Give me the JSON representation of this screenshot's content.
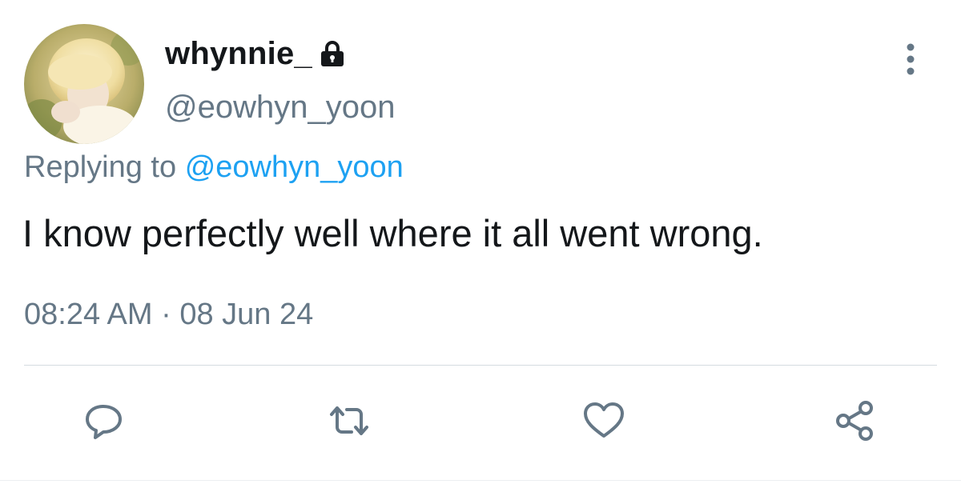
{
  "tweet": {
    "author": {
      "display_name": "whynnie_",
      "handle": "@eowhyn_yoon",
      "protected_icon": "lock-icon",
      "avatar": "profile-photo"
    },
    "reply_to": {
      "prefix": "Replying to",
      "mention": "@eowhyn_yoon"
    },
    "text": "I know perfectly well where it all went wrong.",
    "timestamp": "08:24 AM · 08 Jun 24",
    "menu_icon": "more-vertical-icon"
  },
  "actions": [
    {
      "icon": "reply-icon"
    },
    {
      "icon": "retweet-icon"
    },
    {
      "icon": "like-icon"
    },
    {
      "icon": "share-icon"
    }
  ],
  "colors": {
    "text_primary": "#14171a",
    "text_secondary": "#657786",
    "link": "#1da1f2",
    "divider": "#d5dbe0"
  }
}
